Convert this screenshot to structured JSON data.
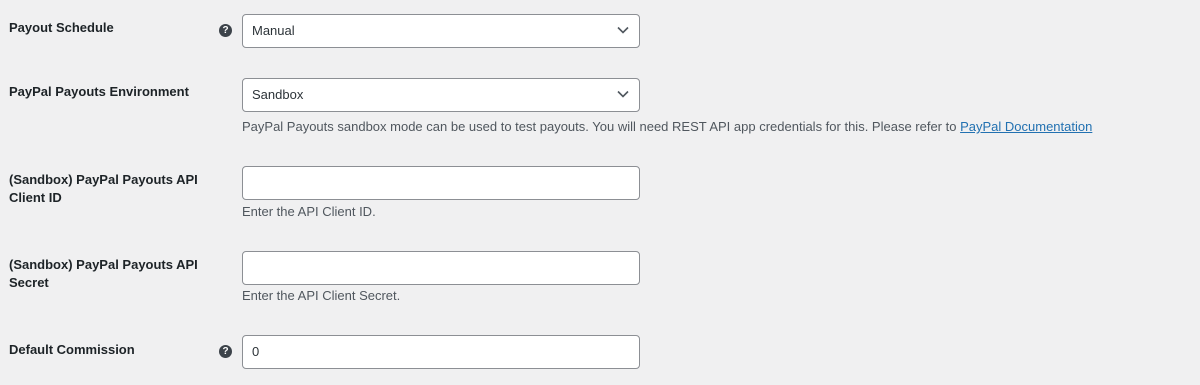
{
  "fields": [
    {
      "label": "Payout Schedule",
      "help_icon": "question-circle-icon",
      "type": "select",
      "value": "Manual",
      "chevron_icon": "chevron-down-icon"
    },
    {
      "label": "PayPal Payouts Environment",
      "type": "select",
      "value": "Sandbox",
      "chevron_icon": "chevron-down-icon",
      "description": "PayPal Payouts sandbox mode can be used to test payouts. You will need REST API app credentials for this. Please refer to ",
      "description_link": "PayPal Documentation"
    },
    {
      "label": "(Sandbox) PayPal Payouts API Client ID",
      "type": "text",
      "value": "",
      "description": "Enter the API Client ID."
    },
    {
      "label": "(Sandbox) PayPal Payouts API Secret",
      "type": "text",
      "value": "",
      "description": "Enter the API Client Secret."
    },
    {
      "label": "Default Commission",
      "help_icon": "question-circle-icon",
      "type": "text",
      "value": "0"
    }
  ],
  "help_glyph": "?"
}
